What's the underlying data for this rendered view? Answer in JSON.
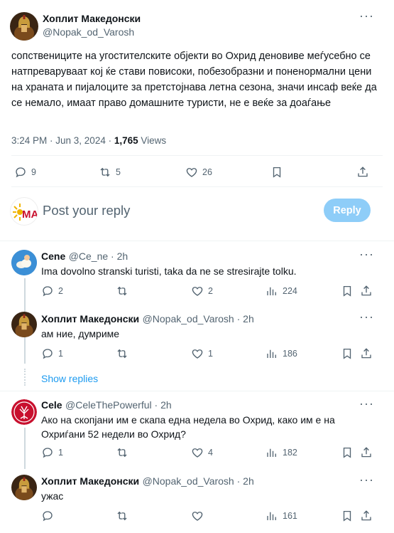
{
  "main_tweet": {
    "author_name": "Хоплит Македонски",
    "author_handle": "@Nopak_od_Varosh",
    "text": "сопствениците на угостителските објекти во Охрид деновиве меѓусебно се натпреваруваат кој ќе стави повисоки, побезобразни и поненормални цени на храната и пијалоците за претстојнава летна сезона, значи инсаф веќе да се немало, имаат право домашните туристи, не е веќе за доаѓање",
    "time_date": "3:24 PM · Jun 3, 2024 · ",
    "views_count": "1,765",
    "views_label": " Views",
    "replies": "9",
    "reposts": "5",
    "likes": "26"
  },
  "compose": {
    "placeholder": "Post your reply",
    "button_label": "Reply"
  },
  "replies": [
    {
      "name": "Cene",
      "handle": "@Ce_ne · 2h",
      "text": "Ima dovolno stranski turisti, taka da ne se stresirajte tolku.",
      "replies": "2",
      "reposts": "",
      "likes": "2",
      "views": "224"
    },
    {
      "name": "Хоплит Македонски",
      "handle": "@Nopak_od_Varosh · 2h",
      "text": "ам ние, думриме",
      "replies": "1",
      "reposts": "",
      "likes": "1",
      "views": "186"
    },
    {
      "name": "Cele",
      "handle": "@CeleThePowerful · 2h",
      "text": "Ако на скопјани им е скапа една недела во Охрид, како им е на Охриѓани 52 недели во Охрид?",
      "replies": "1",
      "reposts": "",
      "likes": "4",
      "views": "182"
    },
    {
      "name": "Хоплит Македонски",
      "handle": "@Nopak_od_Varosh · 2h",
      "text": "ужас",
      "replies": "",
      "reposts": "",
      "likes": "",
      "views": "161"
    }
  ],
  "show_replies_label": "Show replies",
  "colors": {
    "accent": "#1d9bf0",
    "reply_button": "#8ecdf8",
    "text_secondary": "#536471",
    "divider": "#eff3f4"
  },
  "icons": [
    "more-icon",
    "reply-icon",
    "repost-icon",
    "like-icon",
    "bookmark-icon",
    "share-icon",
    "views-icon"
  ]
}
